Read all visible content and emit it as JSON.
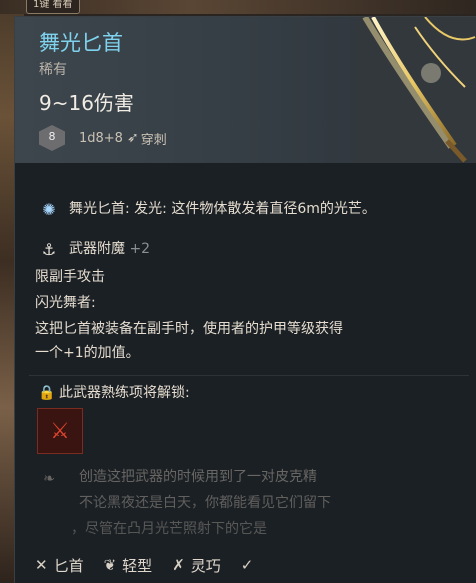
{
  "top_tag": "1键 看看",
  "item": {
    "name": "舞光匕首",
    "rarity": "稀有",
    "damage": "9~16伤害",
    "die": "8",
    "damage_dice": "1d8+8",
    "damage_type": "穿刺"
  },
  "effects": [
    {
      "icon": "glow-icon",
      "text": "舞光匕首: 发光: 这件物体散发着直径6m的光芒。"
    }
  ],
  "enchant": {
    "title": "武器附魔",
    "value": "+2",
    "line1": "限副手攻击",
    "line2": "闪光舞者:",
    "line3": "这把匕首被装备在副手时，使用者的护甲等级获得",
    "line4": "一个+1的加值。"
  },
  "mastery": {
    "title": "此武器熟练项将解锁:"
  },
  "lore": {
    "line1": "创造这把武器的时候用到了一对皮克精",
    "line2": "不论黑夜还是白天，你都能看见它们留下",
    "line3": "，尽管在凸月光芒照射下的它是"
  },
  "footer": {
    "tags": [
      "匕首",
      "轻型",
      "灵巧"
    ]
  },
  "colors": {
    "name": "#7fd3ee",
    "header_bg": "#3d464d",
    "body_bg": "#1b2025",
    "mastery_red": "#e0452f"
  }
}
